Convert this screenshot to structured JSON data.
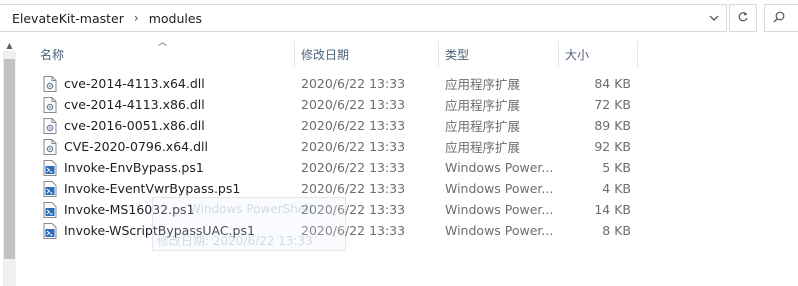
{
  "address": {
    "crumbs": [
      "ElevateKit-master",
      "modules"
    ],
    "separator": "›",
    "dropdown_icon": "chevron-down-icon",
    "refresh_icon": "refresh-icon",
    "search_icon": "search-icon",
    "search_glyph": "⚲"
  },
  "columns": {
    "name": "名称",
    "date": "修改日期",
    "type": "类型",
    "size": "大小"
  },
  "files": [
    {
      "name": "cve-2014-4113.x64.dll",
      "date": "2020/6/22 13:33",
      "type": "应用程序扩展",
      "size": "84 KB",
      "icon": "dll"
    },
    {
      "name": "cve-2014-4113.x86.dll",
      "date": "2020/6/22 13:33",
      "type": "应用程序扩展",
      "size": "72 KB",
      "icon": "dll"
    },
    {
      "name": "cve-2016-0051.x86.dll",
      "date": "2020/6/22 13:33",
      "type": "应用程序扩展",
      "size": "89 KB",
      "icon": "dll"
    },
    {
      "name": "CVE-2020-0796.x64.dll",
      "date": "2020/6/22 13:33",
      "type": "应用程序扩展",
      "size": "92 KB",
      "icon": "dll"
    },
    {
      "name": "Invoke-EnvBypass.ps1",
      "date": "2020/6/22 13:33",
      "type": "Windows Power...",
      "size": "5 KB",
      "icon": "ps1"
    },
    {
      "name": "Invoke-EventVwrBypass.ps1",
      "date": "2020/6/22 13:33",
      "type": "Windows Power...",
      "size": "4 KB",
      "icon": "ps1"
    },
    {
      "name": "Invoke-MS16032.ps1",
      "date": "2020/6/22 13:33",
      "type": "Windows Power...",
      "size": "14 KB",
      "icon": "ps1"
    },
    {
      "name": "Invoke-WScriptBypassUAC.ps1",
      "date": "2020/6/22 13:33",
      "type": "Windows Power...",
      "size": "8 KB",
      "icon": "ps1"
    }
  ],
  "tooltip_ghost": {
    "line1": "Windows PowerShell",
    "line2": "修改日期: 2020/6/22 13:33"
  },
  "colors": {
    "header_text": "#4c607a",
    "meta_text": "#6d6d6d",
    "ps1_icon": "#2a6bbf"
  }
}
